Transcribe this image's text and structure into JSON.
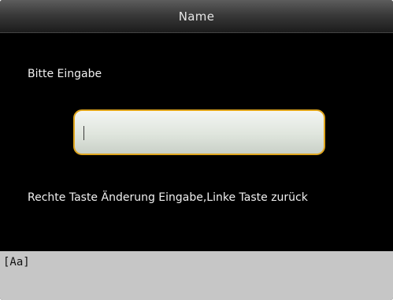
{
  "window": {
    "title": "Name"
  },
  "form": {
    "prompt": "Bitte Eingabe",
    "input_value": "",
    "hint": "Rechte Taste Änderung Eingabe,Linke Taste zurück"
  },
  "statusbar": {
    "input_mode": "[Aa]"
  },
  "colors": {
    "background": "#000000",
    "field_border": "#e0a61e",
    "statusbar": "#c6c6c6"
  }
}
